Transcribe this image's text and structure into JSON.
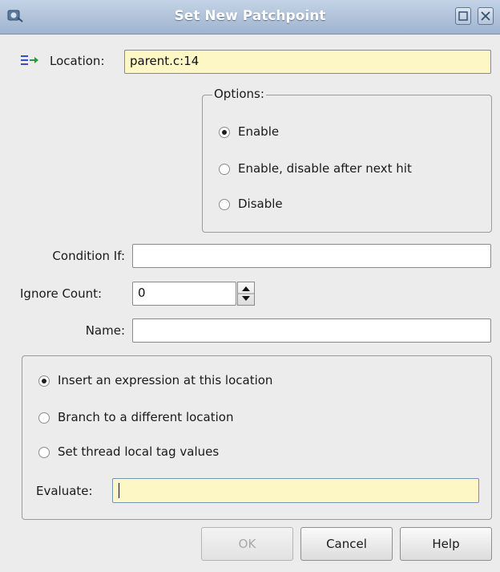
{
  "window": {
    "title": "Set New Patchpoint"
  },
  "location": {
    "label": "Location:",
    "value": "parent.c:14",
    "icon": "location-arrow-icon"
  },
  "options": {
    "legend": "Options:",
    "items": [
      {
        "label": "Enable",
        "selected": true
      },
      {
        "label": "Enable, disable after next hit",
        "selected": false
      },
      {
        "label": "Disable",
        "selected": false
      }
    ]
  },
  "condition": {
    "label": "Condition If:",
    "value": ""
  },
  "ignore_count": {
    "label": "Ignore Count:",
    "value": "0"
  },
  "name": {
    "label": "Name:",
    "value": ""
  },
  "action": {
    "items": [
      {
        "label": "Insert an expression at this location",
        "selected": true
      },
      {
        "label": "Branch to a different location",
        "selected": false
      },
      {
        "label": "Set thread local tag values",
        "selected": false
      }
    ],
    "evaluate_label": "Evaluate:",
    "evaluate_value": ""
  },
  "buttons": {
    "ok": "OK",
    "cancel": "Cancel",
    "help": "Help"
  },
  "colors": {
    "titlebar": "#9fb4cf",
    "highlight_field": "#fdf7c6"
  }
}
